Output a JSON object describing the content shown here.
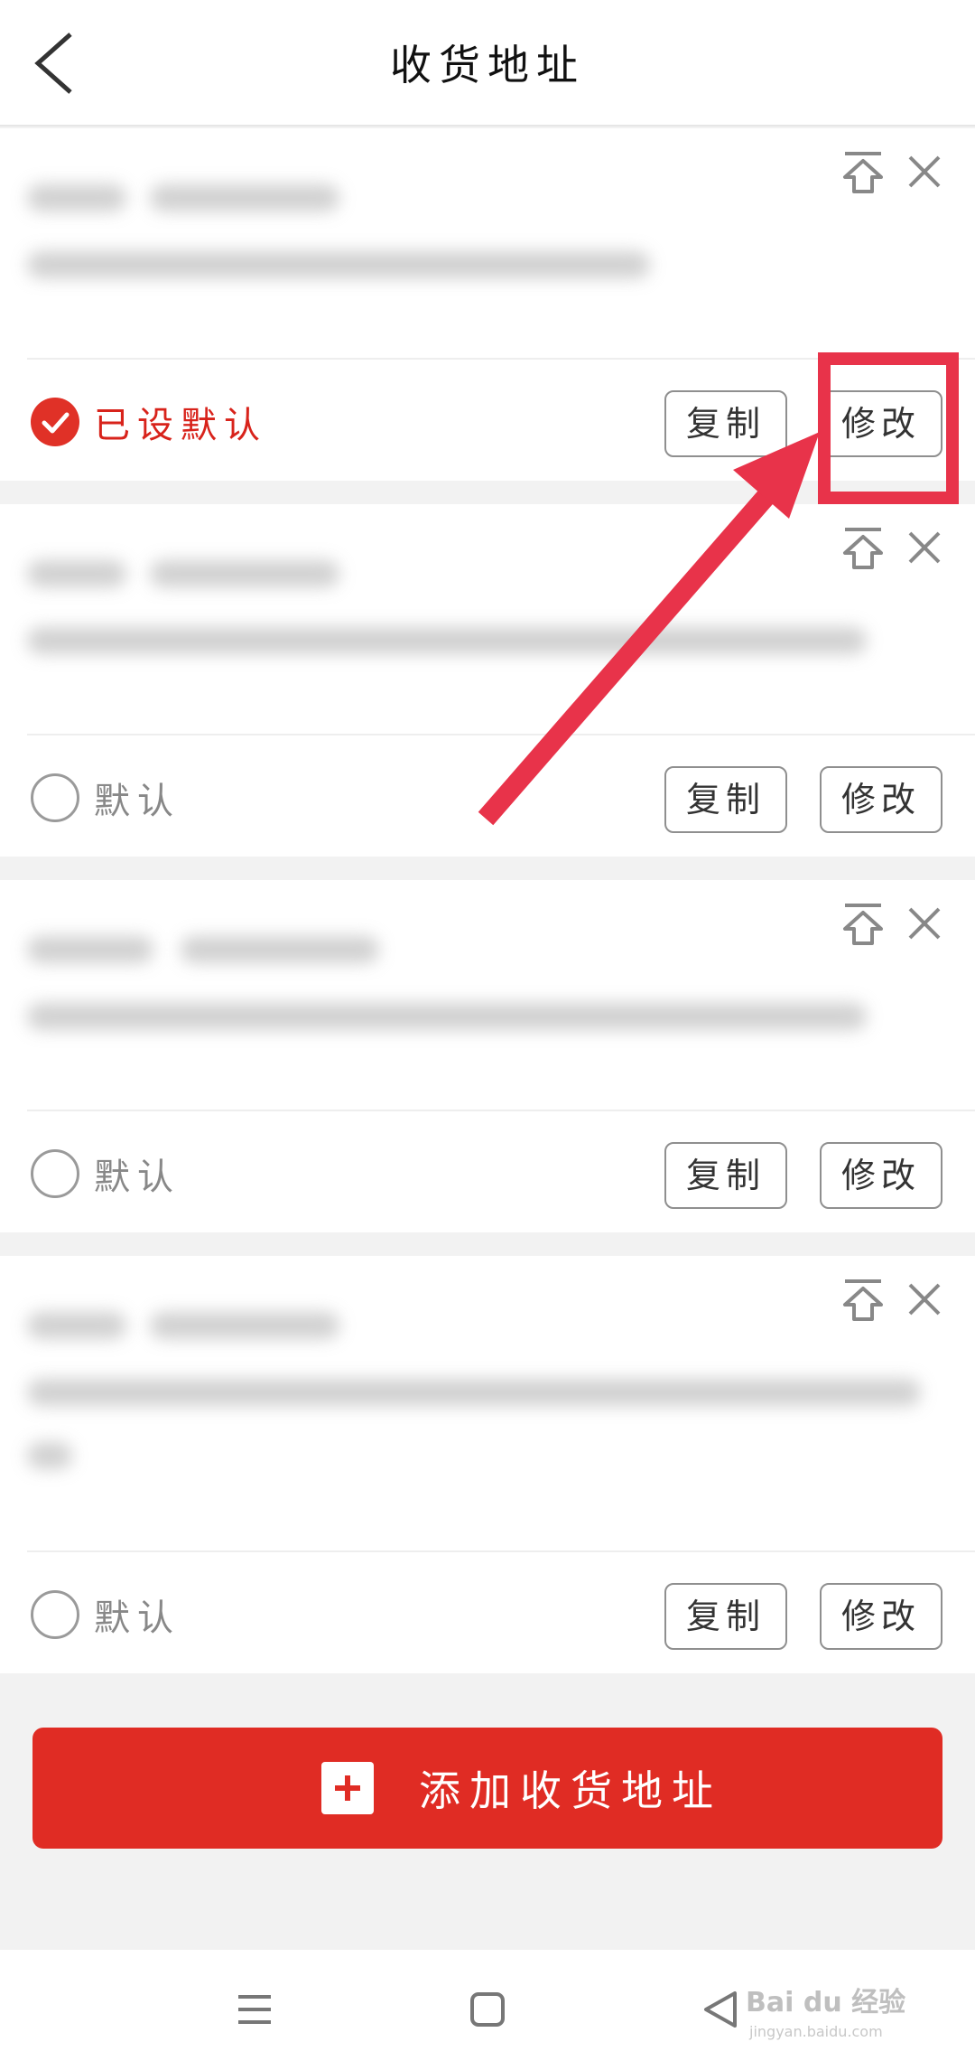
{
  "header": {
    "title": "收货地址"
  },
  "addresses": [
    {
      "is_default": true,
      "default_label": "已设默认",
      "copy_label": "复制",
      "edit_label": "修改"
    },
    {
      "is_default": false,
      "default_label": "默认",
      "copy_label": "复制",
      "edit_label": "修改"
    },
    {
      "is_default": false,
      "default_label": "默认",
      "copy_label": "复制",
      "edit_label": "修改"
    },
    {
      "is_default": false,
      "default_label": "默认",
      "copy_label": "复制",
      "edit_label": "修改"
    }
  ],
  "add_button": {
    "label": "添加收货地址"
  },
  "watermark": {
    "brand": "Bai du 经验",
    "url": "jingyan.baidu.com"
  },
  "colors": {
    "accent": "#e02c24",
    "annotation": "#e8334a"
  },
  "icons": [
    "back-arrow-icon",
    "pin-top-icon",
    "close-icon",
    "check-icon",
    "plus-icon",
    "menu-icon",
    "home-icon",
    "back-triangle-icon"
  ]
}
